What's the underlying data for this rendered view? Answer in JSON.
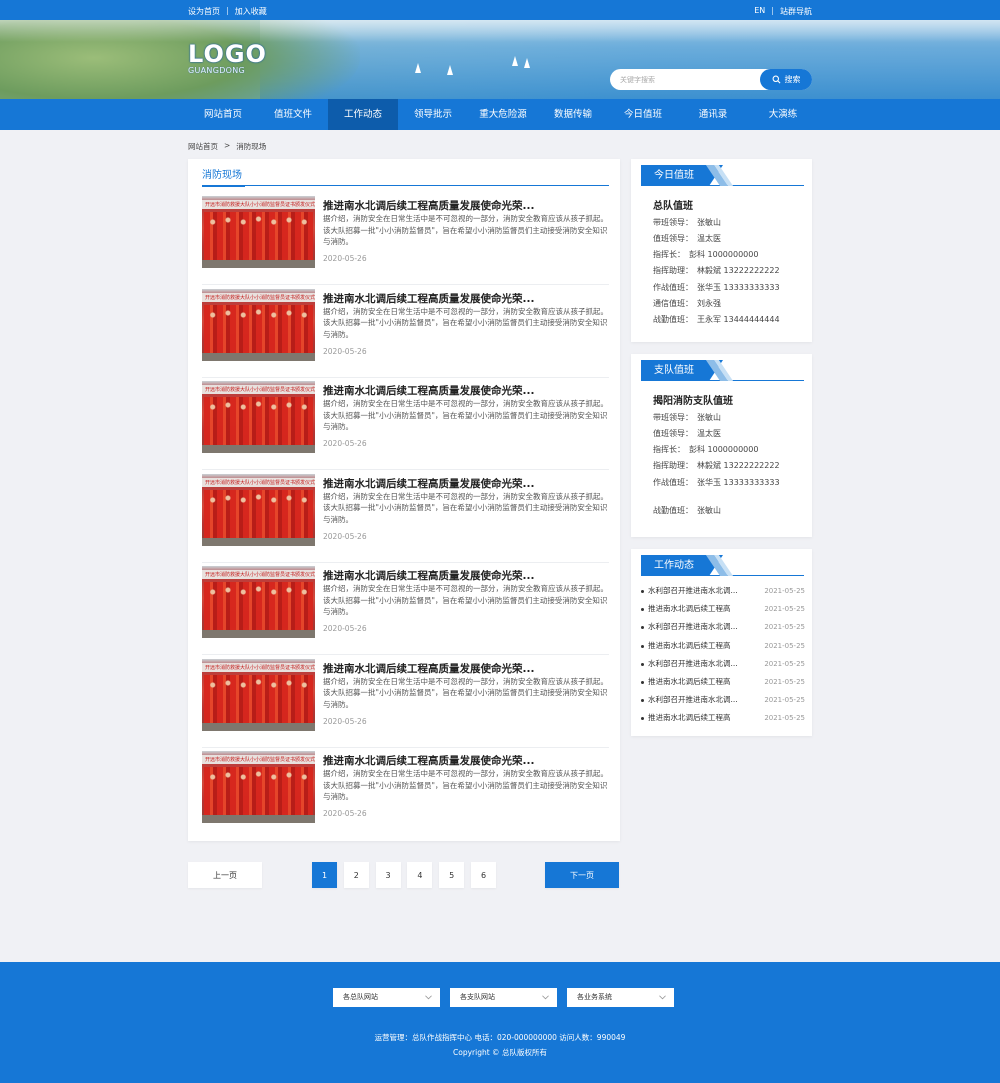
{
  "topbar": {
    "set_home": "设为首页",
    "sep": "|",
    "bookmark": "加入收藏",
    "lang": "EN",
    "site_nav": "站群导航"
  },
  "logo": {
    "text": "LOGO",
    "sub": "GUANGDONG"
  },
  "search": {
    "placeholder": "关键字搜索",
    "button": "搜索"
  },
  "nav": [
    "网站首页",
    "值班文件",
    "工作动态",
    "领导批示",
    "重大危险源",
    "数据传输",
    "今日值班",
    "通讯录",
    "大演练"
  ],
  "nav_active": 2,
  "breadcrumb": {
    "home": "网站首页",
    "sep": ">",
    "current": "消防现场"
  },
  "main": {
    "tab": "消防现场",
    "thumb_caption": "开远市消防救援大队小小消防监督员证书颁发仪式",
    "items": [
      {
        "title": "推进南水北调后续工程高质量发展使命光荣...",
        "desc": "据介绍，消防安全在日常生活中是不可忽视的一部分，消防安全教育应该从孩子抓起。该大队招募一批\"小小消防监督员\"，旨在希望小小消防监督员们主动接受消防安全知识与消防。",
        "date": "2020-05-26"
      },
      {
        "title": "推进南水北调后续工程高质量发展使命光荣...",
        "desc": "据介绍，消防安全在日常生活中是不可忽视的一部分，消防安全教育应该从孩子抓起。该大队招募一批\"小小消防监督员\"，旨在希望小小消防监督员们主动接受消防安全知识与消防。",
        "date": "2020-05-26"
      },
      {
        "title": "推进南水北调后续工程高质量发展使命光荣...",
        "desc": "据介绍，消防安全在日常生活中是不可忽视的一部分，消防安全教育应该从孩子抓起。该大队招募一批\"小小消防监督员\"，旨在希望小小消防监督员们主动接受消防安全知识与消防。",
        "date": "2020-05-26"
      },
      {
        "title": "推进南水北调后续工程高质量发展使命光荣...",
        "desc": "据介绍，消防安全在日常生活中是不可忽视的一部分，消防安全教育应该从孩子抓起。该大队招募一批\"小小消防监督员\"，旨在希望小小消防监督员们主动接受消防安全知识与消防。",
        "date": "2020-05-26"
      },
      {
        "title": "推进南水北调后续工程高质量发展使命光荣...",
        "desc": "据介绍，消防安全在日常生活中是不可忽视的一部分，消防安全教育应该从孩子抓起。该大队招募一批\"小小消防监督员\"，旨在希望小小消防监督员们主动接受消防安全知识与消防。",
        "date": "2020-05-26"
      },
      {
        "title": "推进南水北调后续工程高质量发展使命光荣...",
        "desc": "据介绍，消防安全在日常生活中是不可忽视的一部分，消防安全教育应该从孩子抓起。该大队招募一批\"小小消防监督员\"，旨在希望小小消防监督员们主动接受消防安全知识与消防。",
        "date": "2020-05-26"
      },
      {
        "title": "推进南水北调后续工程高质量发展使命光荣...",
        "desc": "据介绍，消防安全在日常生活中是不可忽视的一部分，消防安全教育应该从孩子抓起。该大队招募一批\"小小消防监督员\"，旨在希望小小消防监督员们主动接受消防安全知识与消防。",
        "date": "2020-05-26"
      }
    ]
  },
  "pagination": {
    "prev": "上一页",
    "next": "下一页",
    "pages": [
      "1",
      "2",
      "3",
      "4",
      "5",
      "6"
    ],
    "current": "1"
  },
  "duty_today": {
    "title": "今日值班",
    "unit": "总队值班",
    "rows": [
      {
        "label": "带班领导：",
        "value": "张敏山"
      },
      {
        "label": "值班领导：",
        "value": "温太医"
      },
      {
        "label": "指挥长：",
        "value": "彭科  1000000000"
      },
      {
        "label": "指挥助理：",
        "value": "林毅斌  13222222222"
      },
      {
        "label": "作战值班：",
        "value": "张华玉  13333333333"
      },
      {
        "label": "通信值班：",
        "value": "刘永强"
      },
      {
        "label": "战勤值班：",
        "value": "王永军  13444444444"
      }
    ]
  },
  "duty_branch": {
    "title": "支队值班",
    "unit": "揭阳消防支队值班",
    "rows": [
      {
        "label": "带班领导：",
        "value": "张敏山"
      },
      {
        "label": "值班领导：",
        "value": "温太医"
      },
      {
        "label": "指挥长：",
        "value": "彭科  1000000000"
      },
      {
        "label": "指挥助理：",
        "value": "林毅斌  13222222222"
      },
      {
        "label": "作战值班：",
        "value": "张华玉  13333333333"
      },
      {
        "label": "战勤值班：",
        "value": "张敏山"
      }
    ]
  },
  "work_news": {
    "title": "工作动态",
    "items": [
      {
        "text": "水利部召开推进南水北调...",
        "date": "2021-05-25"
      },
      {
        "text": "推进南水北调后续工程高",
        "date": "2021-05-25"
      },
      {
        "text": "水利部召开推进南水北调...",
        "date": "2021-05-25"
      },
      {
        "text": "推进南水北调后续工程高",
        "date": "2021-05-25"
      },
      {
        "text": "水利部召开推进南水北调...",
        "date": "2021-05-25"
      },
      {
        "text": "推进南水北调后续工程高",
        "date": "2021-05-25"
      },
      {
        "text": "水利部召开推进南水北调...",
        "date": "2021-05-25"
      },
      {
        "text": "推进南水北调后续工程高",
        "date": "2021-05-25"
      }
    ]
  },
  "footer": {
    "selects": [
      "各总队网站",
      "各支队网站",
      "各业务系统"
    ],
    "info": "运营管理：总队作战指挥中心   电话：020-000000000   访问人数：990049",
    "copyright": "Copyright © 总队版权所有"
  },
  "colors": {
    "primary": "#1677d6",
    "nav_active": "#0d5cab",
    "page_bg": "#f0f1f5"
  }
}
